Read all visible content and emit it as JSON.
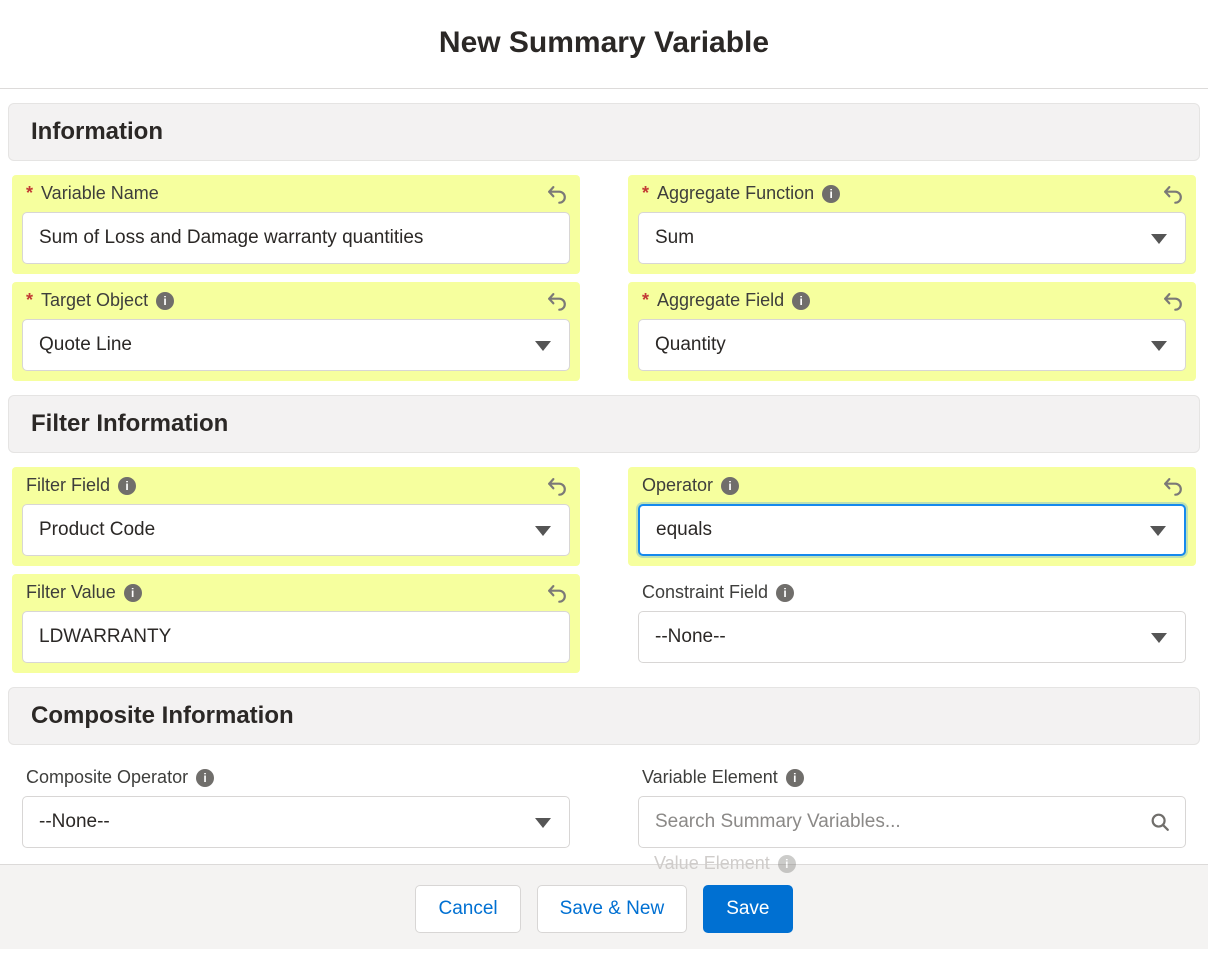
{
  "title": "New Summary Variable",
  "sections": {
    "information": {
      "heading": "Information",
      "variable_name": {
        "label": "Variable Name",
        "value": "Sum of Loss and Damage warranty quantities",
        "required": true
      },
      "aggregate_function": {
        "label": "Aggregate Function",
        "value": "Sum",
        "required": true
      },
      "target_object": {
        "label": "Target Object",
        "value": "Quote Line",
        "required": true
      },
      "aggregate_field": {
        "label": "Aggregate Field",
        "value": "Quantity",
        "required": true
      }
    },
    "filter": {
      "heading": "Filter Information",
      "filter_field": {
        "label": "Filter Field",
        "value": "Product Code"
      },
      "operator": {
        "label": "Operator",
        "value": "equals"
      },
      "filter_value": {
        "label": "Filter Value",
        "value": "LDWARRANTY"
      },
      "constraint_field": {
        "label": "Constraint Field",
        "value": "--None--"
      }
    },
    "composite": {
      "heading": "Composite Information",
      "composite_operator": {
        "label": "Composite Operator",
        "value": "--None--"
      },
      "variable_element": {
        "label": "Variable Element",
        "placeholder": "Search Summary Variables..."
      },
      "value_element": {
        "label": "Value Element"
      }
    }
  },
  "footer": {
    "cancel": "Cancel",
    "save_new": "Save & New",
    "save": "Save"
  }
}
